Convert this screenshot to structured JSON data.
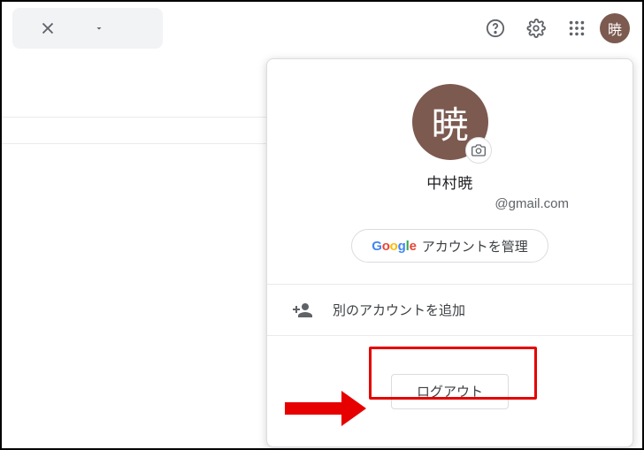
{
  "avatar_initial": "暁",
  "account": {
    "display_name": "中村暁",
    "email": "@gmail.com",
    "manage_prefix_google": "Google",
    "manage_label": "アカウントを管理"
  },
  "add_account_label": "別のアカウントを追加",
  "logout_label": "ログアウト"
}
